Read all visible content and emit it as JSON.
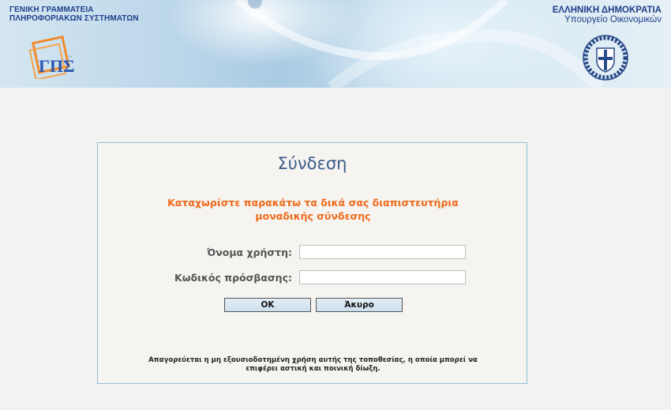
{
  "header": {
    "gsis_title_line1": "ΓΕΝΙΚΗ ΓΡΑΜΜΑΤΕΙΑ",
    "gsis_title_line2": "ΠΛΗΡΟΦΟΡΙΑΚΩΝ ΣΥΣΤΗΜΑΤΩΝ",
    "gsis_logo_text": "ΓΠΣ",
    "gov_title_line1": "ΕΛΛΗΝΙΚΗ ΔΗΜΟΚΡΑΤΙΑ",
    "gov_title_line2": "Υπουργείο Οικονομικών"
  },
  "login": {
    "title": "Σύνδεση",
    "instructions_line1": "Καταχωρίστε παρακάτω τα δικά σας διαπιστευτήρια",
    "instructions_line2": "μοναδικής σύνδεσης",
    "username_label": "Όνομα χρήστη:",
    "username_value": "",
    "password_label": "Κωδικός πρόσβασης:",
    "password_value": "",
    "ok_label": "OK",
    "cancel_label": "Άκυρο",
    "disclaimer_line1": "Απαγορεύεται η μη εξουσιοδοτημένη χρήση αυτής της τοποθεσίας, η οποία μπορεί να",
    "disclaimer_line2": "επιφέρει αστική και ποινική δίωξη."
  },
  "icons": {
    "gsis_logo": "gsis-logo-icon",
    "emblem": "greek-coat-of-arms-icon"
  },
  "colors": {
    "header_blue": "#1f3f8a",
    "instruction_orange": "#ee6a1a",
    "title_blue": "#3a5a8a",
    "box_border": "#8fc0d8"
  }
}
